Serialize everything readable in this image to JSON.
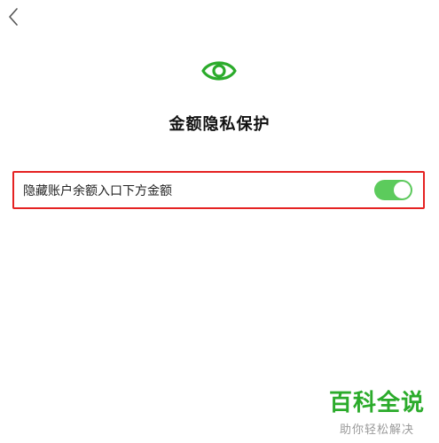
{
  "page": {
    "title": "金额隐私保护"
  },
  "setting": {
    "label": "隐藏账户余额入口下方金额",
    "toggle_on": true
  },
  "watermark": {
    "title": "百科全说",
    "subtitle": "助你轻松解决"
  },
  "colors": {
    "accent_green": "#2bab2b",
    "toggle_green": "#5ccb5c",
    "highlight_border": "#e52222"
  },
  "icons": {
    "back": "chevron-left-icon",
    "privacy": "eye-icon"
  }
}
